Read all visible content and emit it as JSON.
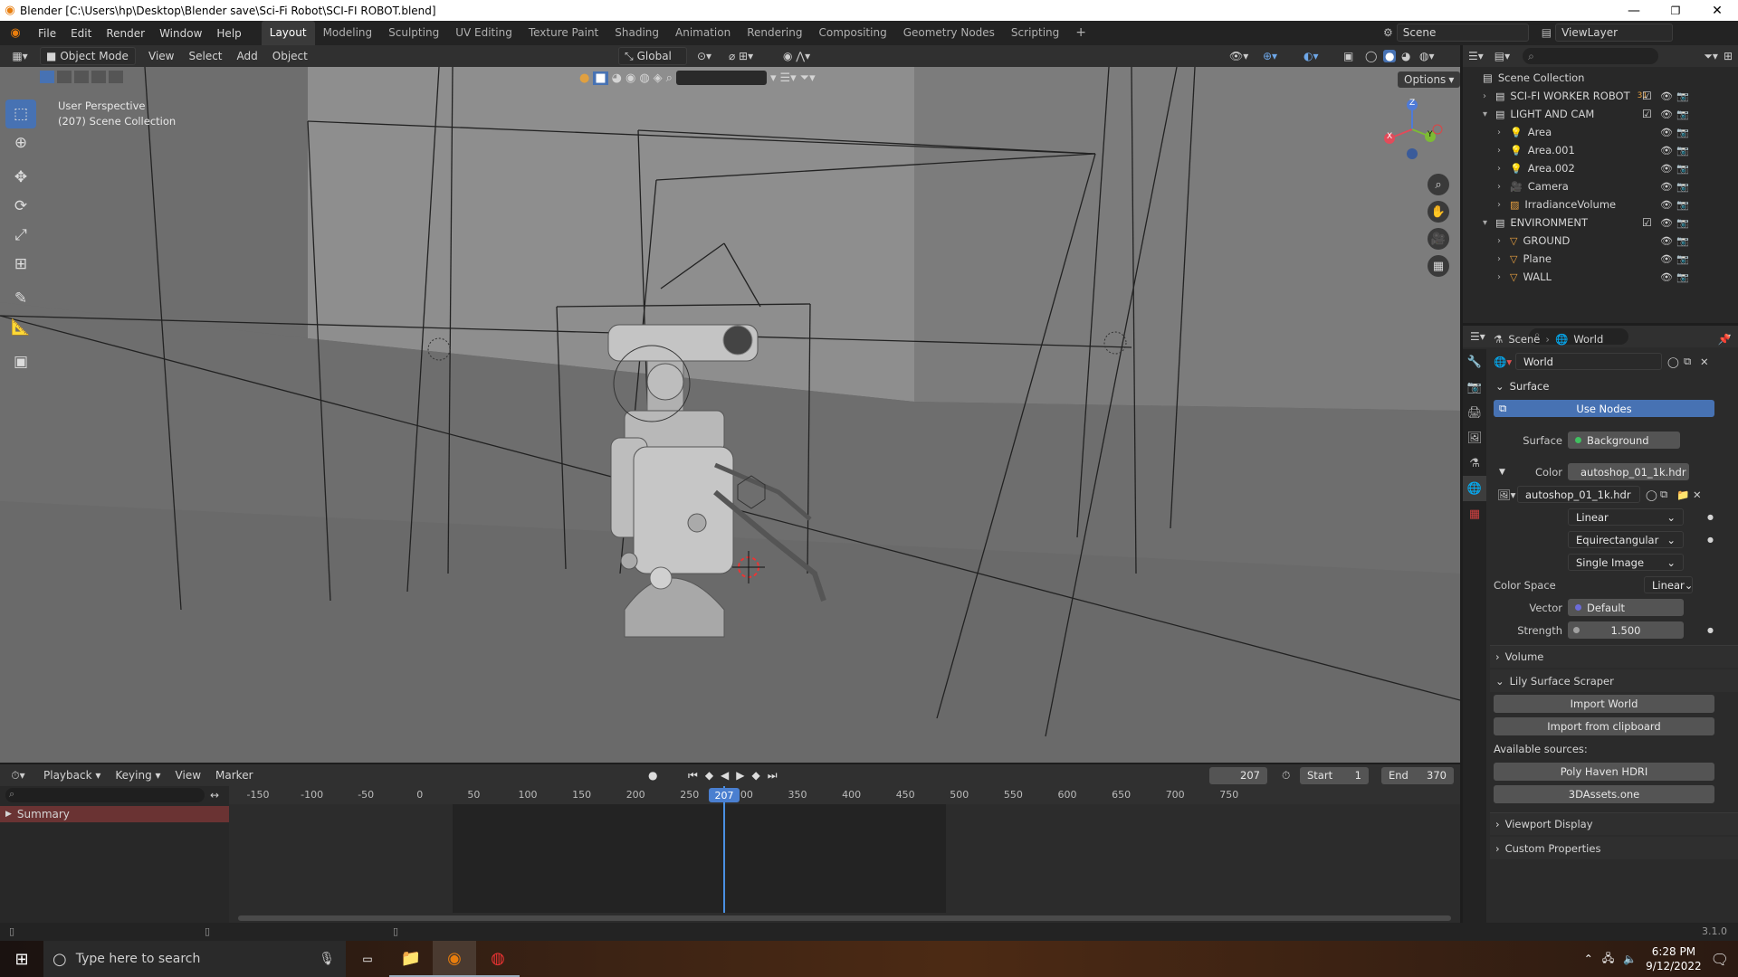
{
  "window": {
    "title": "Blender [C:\\Users\\hp\\Desktop\\Blender save\\Sci-Fi Robot\\SCI-FI ROBOT.blend]",
    "minimize": "—",
    "maximize": "❐",
    "close": "✕"
  },
  "menu": {
    "items": [
      "File",
      "Edit",
      "Render",
      "Window",
      "Help"
    ],
    "workspaces": [
      "Layout",
      "Modeling",
      "Sculpting",
      "UV Editing",
      "Texture Paint",
      "Shading",
      "Animation",
      "Rendering",
      "Compositing",
      "Geometry Nodes",
      "Scripting"
    ],
    "add_workspace": "+",
    "scene": "Scene",
    "view_layer": "ViewLayer"
  },
  "viewport": {
    "mode": "Object Mode",
    "menus": [
      "View",
      "Select",
      "Add",
      "Object"
    ],
    "orientation": "Global",
    "options": "Options",
    "perspective": "User Perspective",
    "collection_info": "(207) Scene Collection",
    "gizmo_axes": [
      "Z",
      "Y",
      "X"
    ]
  },
  "outliner": {
    "root": "Scene Collection",
    "rows": [
      {
        "name": "SCI-FI WORKER ROBOT",
        "kind": "collection",
        "level": 1,
        "badge": "31"
      },
      {
        "name": "LIGHT AND CAM",
        "kind": "collection",
        "level": 1,
        "badge": ""
      },
      {
        "name": "Area",
        "kind": "light",
        "level": 2,
        "badge": ""
      },
      {
        "name": "Area.001",
        "kind": "light",
        "level": 2,
        "badge": ""
      },
      {
        "name": "Area.002",
        "kind": "light",
        "level": 2,
        "badge": ""
      },
      {
        "name": "Camera",
        "kind": "camera",
        "level": 2,
        "badge": ""
      },
      {
        "name": "IrradianceVolume",
        "kind": "probe",
        "level": 2,
        "badge": ""
      },
      {
        "name": "ENVIRONMENT",
        "kind": "collection",
        "level": 1,
        "badge": ""
      },
      {
        "name": "GROUND",
        "kind": "mesh",
        "level": 2,
        "badge": ""
      },
      {
        "name": "Plane",
        "kind": "mesh",
        "level": 2,
        "badge": ""
      },
      {
        "name": "WALL",
        "kind": "mesh",
        "level": 2,
        "badge": ""
      }
    ]
  },
  "properties": {
    "breadcrumb": [
      "Scene",
      "World"
    ],
    "world_name": "World",
    "surface_panel": "Surface",
    "use_nodes": "Use Nodes",
    "surface_label": "Surface",
    "surface_value": "Background",
    "color_label": "Color",
    "color_value": "autoshop_01_1k.hdr",
    "image_name": "autoshop_01_1k.hdr",
    "interpolation": "Linear",
    "projection": "Equirectangular",
    "source": "Single Image",
    "color_space_label": "Color Space",
    "color_space_value": "Linear",
    "vector_label": "Vector",
    "vector_value": "Default",
    "strength_label": "Strength",
    "strength_value": "1.500",
    "volume_panel": "Volume",
    "addon_panel": "Lily Surface Scraper",
    "import_world": "Import World",
    "import_clipboard": "Import from clipboard",
    "available_sources": "Available sources:",
    "source_1": "Poly Haven HDRI",
    "source_2": "3DAssets.one",
    "viewport_display": "Viewport Display",
    "custom_properties": "Custom Properties"
  },
  "timeline": {
    "menus": [
      "Playback",
      "Keying",
      "View",
      "Marker"
    ],
    "current_frame": "207",
    "start_label": "Start",
    "start_value": "1",
    "end_label": "End",
    "end_value": "370",
    "ruler": [
      "-150",
      "-100",
      "-50",
      "0",
      "50",
      "100",
      "150",
      "200",
      "250",
      "300",
      "350",
      "400",
      "450",
      "500",
      "550",
      "600",
      "650",
      "700",
      "750"
    ],
    "summary": "Summary"
  },
  "status": {
    "version": "3.1.0"
  },
  "taskbar": {
    "search_placeholder": "Type here to search",
    "time": "6:28 PM",
    "date": "9/12/2022"
  },
  "colors": {
    "accent_blue": "#4772b3",
    "blender_orange": "#e87d0d",
    "viewport_grey": "#6b6b6b",
    "playhead_blue": "#4a90e2"
  }
}
